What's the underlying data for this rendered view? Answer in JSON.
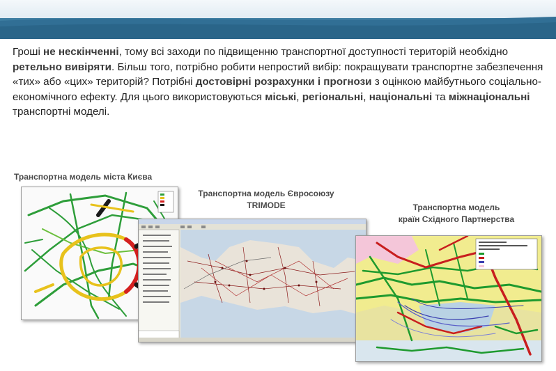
{
  "paragraph": {
    "t1": "Гроші ",
    "b1": "не нескінченні",
    "t2": ", тому всі заходи по підвищенню транспортної доступності територій необхідно ",
    "b2": "ретельно вивіряти",
    "t3": ". Більш того, потрібно робити непростий вибір: покращувати транспортне забезпечення «тих» або «цих» територій? Потрібні ",
    "b3": "достовірні розрахунки і прогнози",
    "t4": " з оцінкою майбутнього соціально-економічного ефекту. Для цього використовуються ",
    "b4": "міські",
    "t5": ", ",
    "b5": "регіональні",
    "t6": ", ",
    "b6": "національні",
    "t7": " та ",
    "b7": "міжнаціональні",
    "t8": " транспортні моделі."
  },
  "captions": {
    "kyiv": "Транспортна модель міста Києва",
    "eu_line1": "Транспортна модель Євросоюзу",
    "eu_line2": "TRIMODE",
    "eap_line1": "Транспортна модель",
    "eap_line2": "країн Східного Партнерства"
  },
  "images": {
    "kyiv_map": "kyiv-network-map",
    "eu_map": "eu-trimode-software-map",
    "eap_map": "eap-model-map"
  },
  "colors": {
    "banner": "#2a6a90",
    "network_green": "#2e9e3a",
    "network_yellow": "#e8c21c",
    "network_red": "#d42020"
  }
}
